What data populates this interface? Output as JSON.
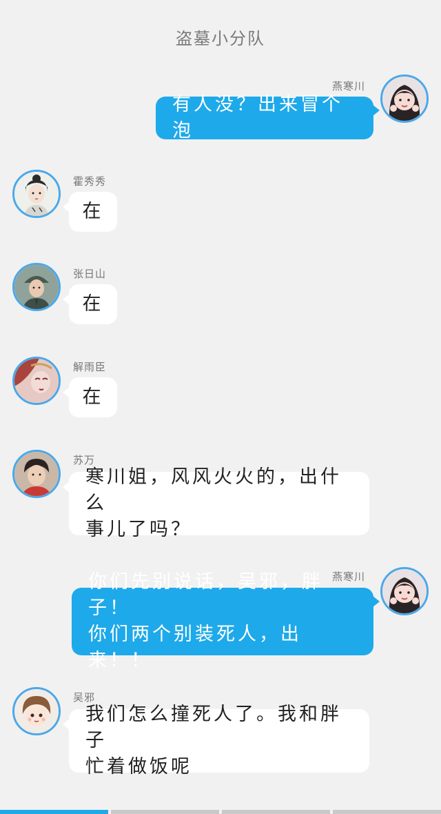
{
  "header": {
    "title": "盗墓小分队"
  },
  "messages": [
    {
      "side": "right",
      "sender": "燕寒川",
      "text": "有人没？出来冒个泡"
    },
    {
      "side": "left",
      "sender": "霍秀秀",
      "text": "在"
    },
    {
      "side": "left",
      "sender": "张日山",
      "text": "在"
    },
    {
      "side": "left",
      "sender": "解雨臣",
      "text": "在"
    },
    {
      "side": "left",
      "sender": "苏万",
      "text": "寒川姐，风风火火的，出什么\n事儿了吗？"
    },
    {
      "side": "right",
      "sender": "燕寒川",
      "text": "你们先别说话，吴邪，胖子！\n你们两个别装死人，出来！！"
    },
    {
      "side": "left",
      "sender": "吴邪",
      "text": "我们怎么撞死人了。我和胖子\n忙着做饭呢"
    }
  ],
  "colors": {
    "background": "#f1f1f1",
    "right_bubble": "#1ea9ea",
    "left_bubble": "#ffffff",
    "avatar_ring": "#4aa8ea",
    "progress_active": "#1ea9ea"
  },
  "progress": {
    "segments": 4,
    "current": 1,
    "active_fill": 1.0
  }
}
